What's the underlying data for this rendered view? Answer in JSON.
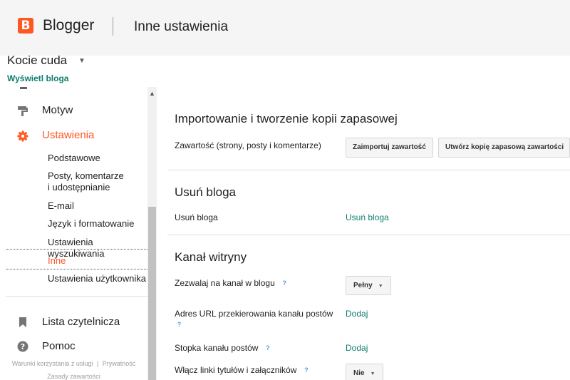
{
  "header": {
    "logo_letter": "B",
    "brand": "Blogger",
    "page_title": "Inne ustawienia"
  },
  "blog": {
    "name": "Kocie cuda",
    "view_link": "Wyświetl bloga"
  },
  "sidebar": {
    "main": [
      {
        "label": "Motyw",
        "icon": "paint-roller-icon"
      },
      {
        "label": "Ustawienia",
        "icon": "gear-icon",
        "active": true,
        "color": "#ff5722"
      }
    ],
    "settings_items": [
      {
        "label": "Podstawowe"
      },
      {
        "label": "Posty, komentarze"
      },
      {
        "label": "i udostępnianie"
      },
      {
        "label": "E-mail"
      },
      {
        "label": "Język i formatowanie"
      },
      {
        "label": "Ustawienia wyszukiwania"
      },
      {
        "label": "Inne",
        "active": true
      },
      {
        "label": "Ustawienia użytkownika"
      }
    ],
    "bottom": [
      {
        "label": "Lista czytelnicza",
        "icon": "bookmark-icon"
      },
      {
        "label": "Pomoc",
        "icon": "help-icon"
      }
    ],
    "footer": {
      "terms": "Warunki korzystania z usługi",
      "separator": "|",
      "privacy": "Prywatność",
      "content_policy": "Zasady zawartości"
    }
  },
  "import_section": {
    "title": "Importowanie i tworzenie kopii zapasowej",
    "content_label": "Zawartość (strony, posty i komentarze)",
    "import_button": "Zaimportuj zawartość",
    "backup_button": "Utwórz kopię zapasową zawartości"
  },
  "delete_section": {
    "title": "Usuń bloga",
    "row_label": "Usuń bloga",
    "link": "Usuń bloga"
  },
  "feed_section": {
    "title": "Kanał witryny",
    "allow_feed_label": "Zezwalaj na kanał w blogu",
    "allow_feed_value": "Pełny",
    "redirect_label_line1": "Adres URL przekierowania kanału postów",
    "redirect_link": "Dodaj",
    "footer_label": "Stopka kanału postów",
    "footer_link": "Dodaj",
    "title_links_label": "Włącz linki tytułów i załączników",
    "title_links_value": "Nie",
    "help_glyph": "?"
  },
  "colors": {
    "accent": "#ff5722",
    "link": "#0e7e6d",
    "help": "#5c9bd3"
  }
}
